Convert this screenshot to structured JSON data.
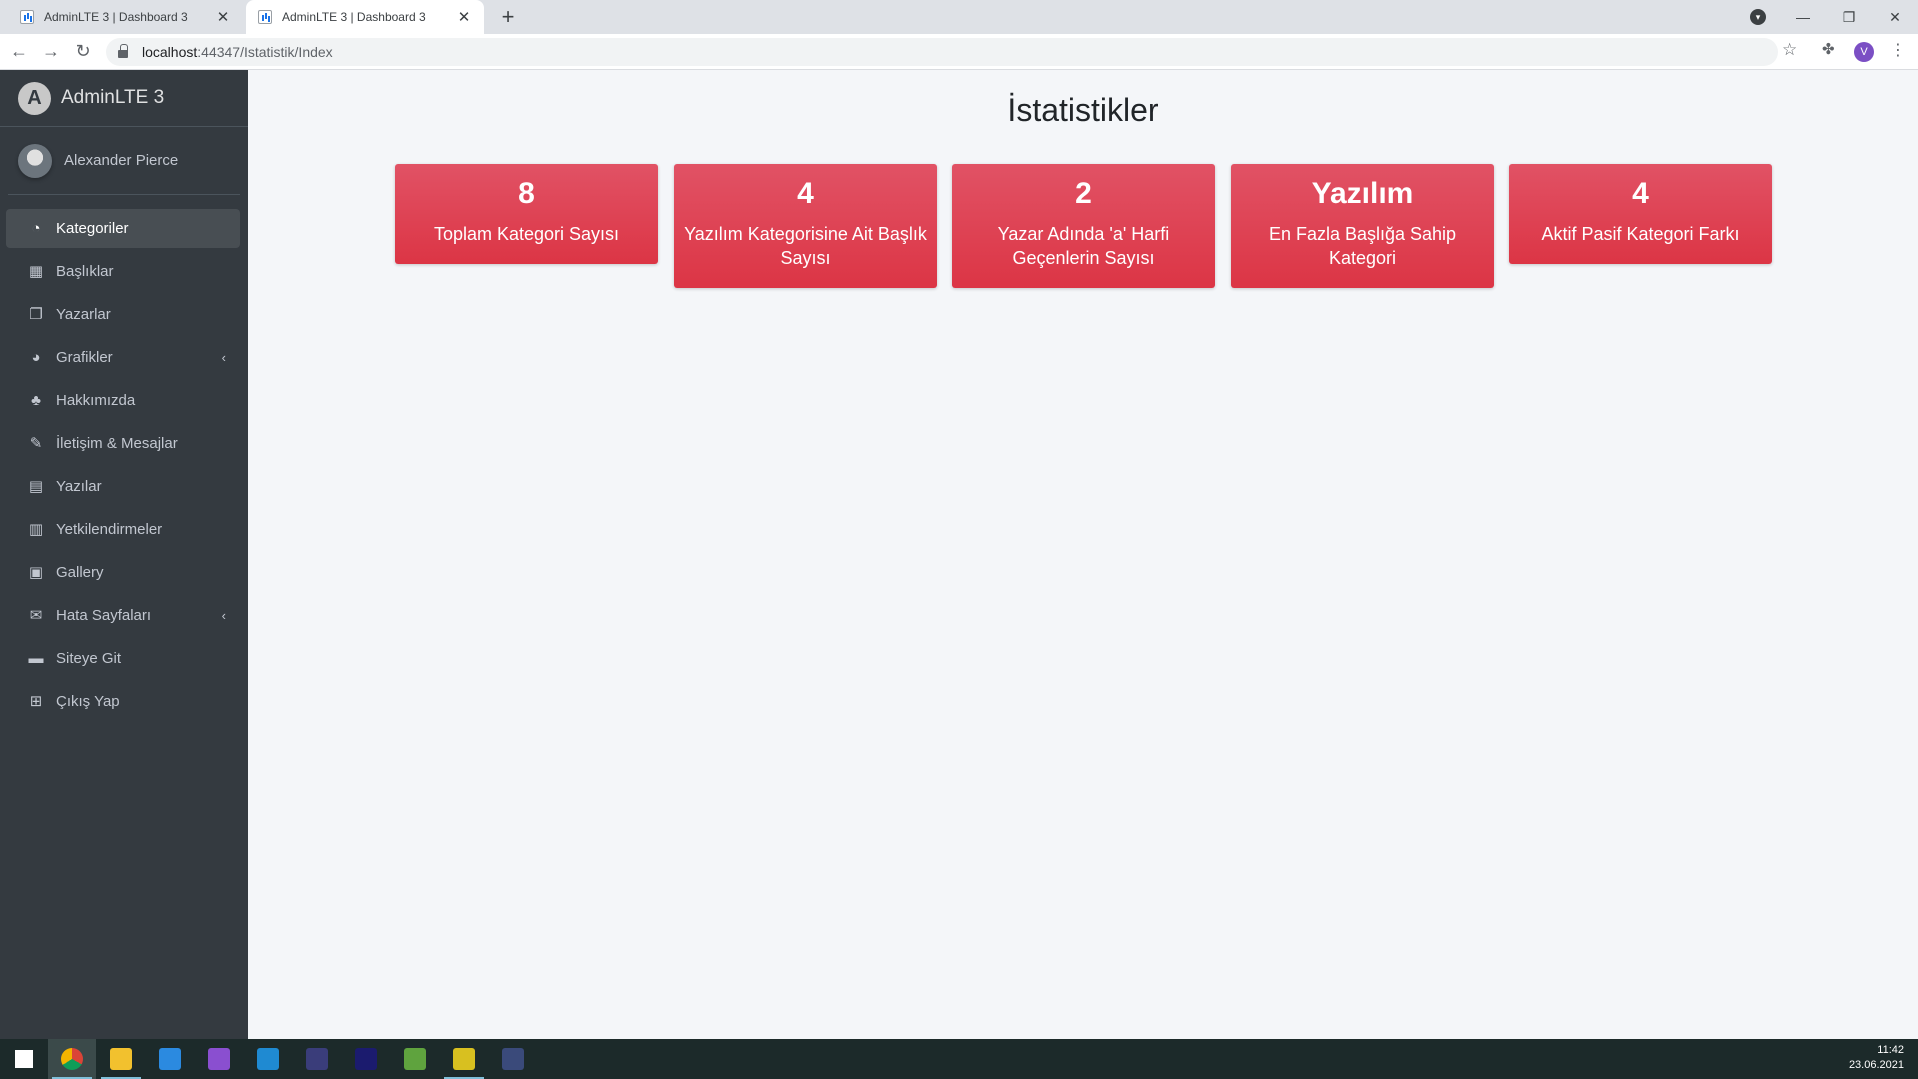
{
  "browser": {
    "tabs": [
      {
        "title": "AdminLTE 3 | Dashboard 3",
        "active": false
      },
      {
        "title": "AdminLTE 3 | Dashboard 3",
        "active": true
      }
    ],
    "url_host": "localhost",
    "url_path": ":44347/Istatistik/Index",
    "profile_letter": "V"
  },
  "sidebar": {
    "brand": "AdminLTE 3",
    "user_name": "Alexander Pierce",
    "items": [
      {
        "label": "Kategoriler",
        "icon": "dashboard-icon",
        "glyph": "◔",
        "active": true
      },
      {
        "label": "Başlıklar",
        "icon": "grid-icon",
        "glyph": "▦"
      },
      {
        "label": "Yazarlar",
        "icon": "copy-icon",
        "glyph": "❐"
      },
      {
        "label": "Grafikler",
        "icon": "pie-chart-icon",
        "glyph": "◕",
        "caret": "‹"
      },
      {
        "label": "Hakkımızda",
        "icon": "tree-icon",
        "glyph": "♣"
      },
      {
        "label": "İletişim & Mesajlar",
        "icon": "edit-icon",
        "glyph": "✎"
      },
      {
        "label": "Yazılar",
        "icon": "table-icon",
        "glyph": "▤"
      },
      {
        "label": "Yetkilendirmeler",
        "icon": "calendar-icon",
        "glyph": "▥"
      },
      {
        "label": "Gallery",
        "icon": "image-icon",
        "glyph": "▣"
      },
      {
        "label": "Hata Sayfaları",
        "icon": "envelope-icon",
        "glyph": "✉",
        "caret": "‹"
      },
      {
        "label": "Siteye Git",
        "icon": "book-icon",
        "glyph": "▬"
      },
      {
        "label": "Çıkış Yap",
        "icon": "plus-square-icon",
        "glyph": "⊞"
      }
    ]
  },
  "main": {
    "title": "İstatistikler",
    "stats": [
      {
        "value": "8",
        "label": "Toplam Kategori Sayısı"
      },
      {
        "value": "4",
        "label": "Yazılım Kategorisine Ait Başlık Sayısı"
      },
      {
        "value": "2",
        "label": "Yazar Adında 'a' Harfi Geçenlerin Sayısı"
      },
      {
        "value": "Yazılım",
        "label": "En Fazla Başlığa Sahip Kategori"
      },
      {
        "value": "4",
        "label": "Aktif Pasif Kategori Farkı"
      }
    ]
  },
  "taskbar": {
    "time": "11:42",
    "date": "23.06.2021",
    "apps": [
      {
        "name": "windows-start-icon",
        "color": "#ffffff"
      },
      {
        "name": "chrome-icon",
        "color": "#e8b400"
      },
      {
        "name": "file-explorer-icon",
        "color": "#f2c12e"
      },
      {
        "name": "mail-icon",
        "color": "#2b8ae0"
      },
      {
        "name": "visual-studio-icon",
        "color": "#8a4fd0"
      },
      {
        "name": "vscode-icon",
        "color": "#1f8ad2"
      },
      {
        "name": "eclipse-icon",
        "color": "#3a3d7a"
      },
      {
        "name": "jetbrains-icon",
        "color": "#1b1b6e"
      },
      {
        "name": "node-icon",
        "color": "#5fa33e"
      },
      {
        "name": "pycharm-icon",
        "color": "#d8c020"
      },
      {
        "name": "terminal-icon",
        "color": "#3a4a7a"
      }
    ]
  },
  "colors": {
    "sidebar_bg": "#343a40",
    "card_red": "#dc3545",
    "content_bg": "#f4f6f9"
  }
}
